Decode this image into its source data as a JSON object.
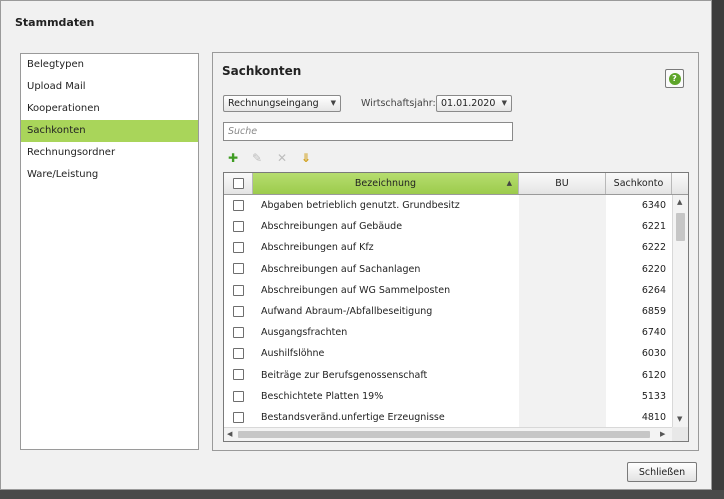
{
  "dialog": {
    "title": "Stammdaten",
    "close_label": "Schließen"
  },
  "nav": {
    "items": [
      {
        "label": "Belegtypen",
        "active": false
      },
      {
        "label": "Upload Mail",
        "active": false
      },
      {
        "label": "Kooperationen",
        "active": false
      },
      {
        "label": "Sachkonten",
        "active": true
      },
      {
        "label": "Rechnungsordner",
        "active": false
      },
      {
        "label": "Ware/Leistung",
        "active": false
      }
    ]
  },
  "panel": {
    "title": "Sachkonten",
    "help_icon": "question-icon",
    "type_select": "Rechnungseingang",
    "year_label": "Wirtschaftsjahr:",
    "year_select": "01.01.2020",
    "search_placeholder": "Suche",
    "toolbar": [
      "add-icon",
      "edit-icon",
      "delete-icon",
      "import-icon"
    ]
  },
  "table": {
    "columns": {
      "bez": "Bezeichnung",
      "bu": "BU",
      "kto": "Sachkonto"
    },
    "sorted_column": "Bezeichnung",
    "rows": [
      {
        "bez": "Abgaben betrieblich genutzt. Grundbesitz",
        "bu": "",
        "kto": "6340"
      },
      {
        "bez": "Abschreibungen auf Gebäude",
        "bu": "",
        "kto": "6221"
      },
      {
        "bez": "Abschreibungen auf Kfz",
        "bu": "",
        "kto": "6222"
      },
      {
        "bez": "Abschreibungen auf Sachanlagen",
        "bu": "",
        "kto": "6220"
      },
      {
        "bez": "Abschreibungen auf WG Sammelposten",
        "bu": "",
        "kto": "6264"
      },
      {
        "bez": "Aufwand Abraum-/Abfallbeseitigung",
        "bu": "",
        "kto": "6859"
      },
      {
        "bez": "Ausgangsfrachten",
        "bu": "",
        "kto": "6740"
      },
      {
        "bez": "Aushilfslöhne",
        "bu": "",
        "kto": "6030"
      },
      {
        "bez": "Beiträge zur Berufsgenossenschaft",
        "bu": "",
        "kto": "6120"
      },
      {
        "bez": "Beschichtete Platten 19%",
        "bu": "",
        "kto": "5133"
      },
      {
        "bez": "Bestandsveränd.unfertige Erzeugnisse",
        "bu": "",
        "kto": "4810"
      }
    ]
  },
  "colors": {
    "accent": "#a9d55a",
    "help": "#5ea52a"
  }
}
